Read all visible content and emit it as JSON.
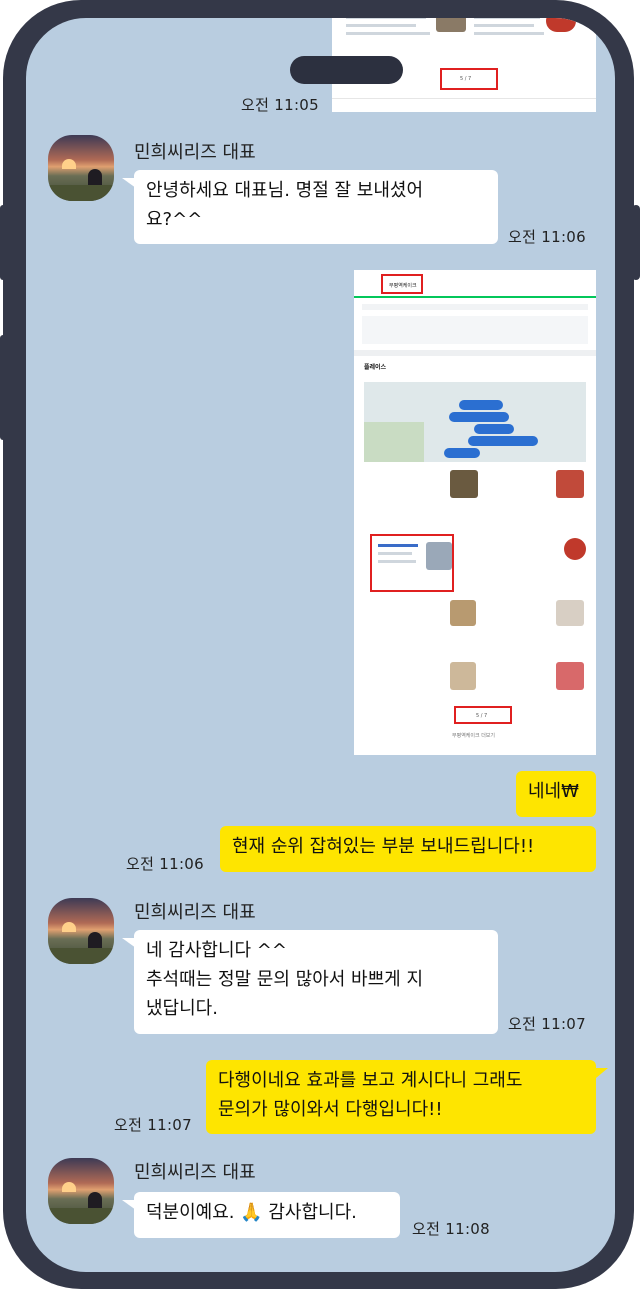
{
  "chat": {
    "sender_name": "민희씨리즈 대표",
    "messages": [
      {
        "id": "m0",
        "side": "right",
        "type": "image",
        "time": "오전 11:05",
        "mini_label": "5 / 7"
      },
      {
        "id": "m1",
        "side": "left",
        "text": "안녕하세요 대표님. 명절 잘 보내셨어\n요?^^",
        "time": "오전 11:06"
      },
      {
        "id": "m2",
        "side": "right",
        "type": "image",
        "search_text": "부평역케이크",
        "section_title": "플레이스",
        "page_indicator": "5 / 7",
        "more_label": "부평역케이크 더보기"
      },
      {
        "id": "m3",
        "side": "right",
        "text": "네네₩"
      },
      {
        "id": "m4",
        "side": "right",
        "text": "현재 순위 잡혀있는 부분 보내드립니다!!",
        "time": "오전 11:06"
      },
      {
        "id": "m5",
        "side": "left",
        "text": "네 감사합니다 ^^\n추석때는 정말 문의 많아서 바쁘게 지\n냈답니다.",
        "time": "오전 11:07"
      },
      {
        "id": "m6",
        "side": "right",
        "text": "다행이네요 효과를 보고 계시다니 그래도\n문의가 많이와서 다행입니다!!",
        "time": "오전 11:07"
      },
      {
        "id": "m7",
        "side": "left",
        "text": "덕분이예요. 🙏 감사합니다.",
        "time": "오전 11:08"
      }
    ]
  },
  "colors": {
    "chat_bg": "#b9cde0",
    "my_bubble": "#fee500",
    "their_bubble": "#ffffff",
    "highlight": "#e02020",
    "frame": "#343848"
  }
}
